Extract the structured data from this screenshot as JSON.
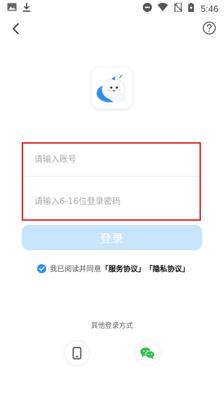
{
  "status_bar": {
    "time": "5:46",
    "icons": [
      "image-icon",
      "download-icon",
      "do-not-disturb-icon",
      "wifi-icon",
      "no-sim-icon",
      "battery-charging-icon"
    ]
  },
  "header": {
    "back_icon": "chevron-left-icon",
    "help_icon": "help-circle-icon"
  },
  "logo": {
    "icon": "app-mascot-logo"
  },
  "form": {
    "account_placeholder": "请输入账号",
    "account_value": "",
    "password_placeholder": "请输入6-16位登录密码",
    "password_value": "",
    "highlight_color": "#e02020"
  },
  "login_button": {
    "label": "登录",
    "color": "#c9e5fb"
  },
  "agreement": {
    "checked": true,
    "prefix": "我已阅读并同意",
    "service_link": "「服务协议」",
    "privacy_link": "「隐私协议」"
  },
  "other_login": {
    "title": "其他登录方式",
    "methods": [
      {
        "icon": "phone-icon"
      },
      {
        "icon": "wechat-icon",
        "color": "#2bc04c"
      }
    ]
  }
}
